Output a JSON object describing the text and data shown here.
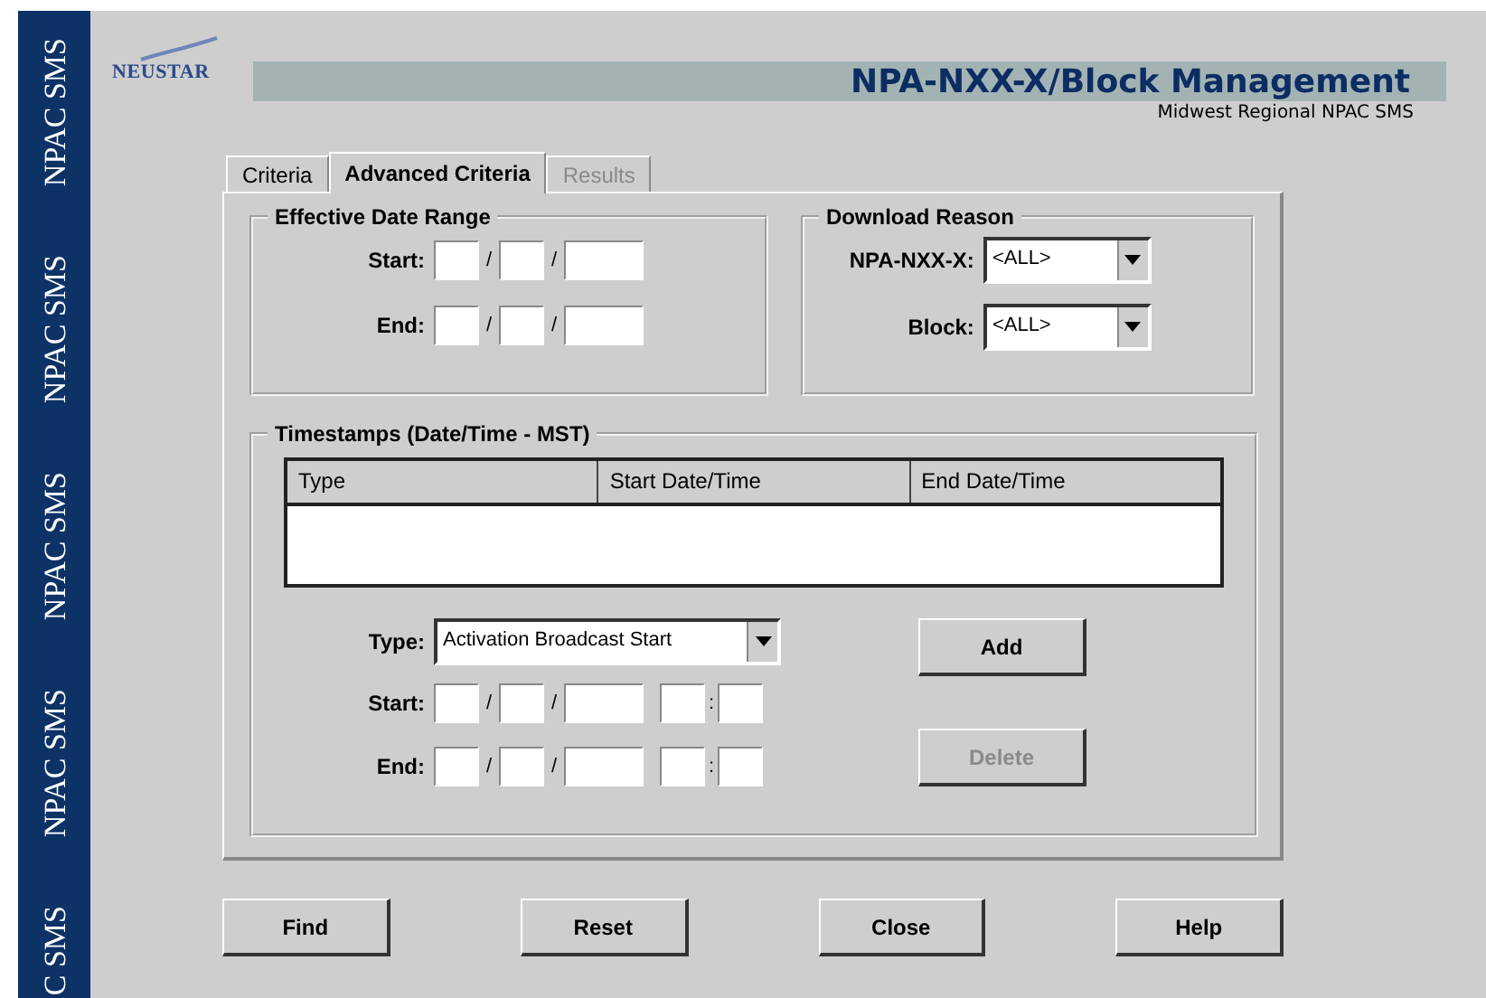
{
  "sidebar": {
    "labels": [
      "NPAC SMS",
      "NPAC SMS",
      "NPAC SMS",
      "NPAC SMS",
      "C SMS"
    ]
  },
  "logo": {
    "text": "NEUSTAR"
  },
  "header": {
    "title": "NPA-NXX-X/Block Management",
    "subtitle": "Midwest Regional NPAC SMS"
  },
  "tabs": [
    {
      "label": "Criteria",
      "selected": false,
      "disabled": false
    },
    {
      "label": "Advanced Criteria",
      "selected": true,
      "disabled": false
    },
    {
      "label": "Results",
      "selected": false,
      "disabled": true
    }
  ],
  "effective_date_range": {
    "title": "Effective Date Range",
    "rows": [
      {
        "label": "Start:",
        "separators": [
          "/",
          "/"
        ]
      },
      {
        "label": "End:",
        "separators": [
          "/",
          "/"
        ]
      }
    ]
  },
  "download_reason": {
    "title": "Download Reason",
    "dropdowns": [
      {
        "label": "NPA-NXX-X:",
        "value": "<ALL>"
      },
      {
        "label": "Block:",
        "value": "<ALL>"
      }
    ]
  },
  "timestamps": {
    "title": "Timestamps (Date/Time - MST)",
    "table": {
      "columns": [
        "Type",
        "Start Date/Time",
        "End Date/Time"
      ]
    },
    "type_dropdown": {
      "label": "Type:",
      "value": "Activation Broadcast Start"
    },
    "rows": [
      {
        "label": "Start:",
        "separators": [
          "/",
          "/",
          ":"
        ]
      },
      {
        "label": "End:",
        "separators": [
          "/",
          "/",
          ":"
        ]
      }
    ],
    "buttons": [
      {
        "label": "Add",
        "disabled": false
      },
      {
        "label": "Delete",
        "disabled": true
      }
    ]
  },
  "buttons": [
    {
      "label": "Find",
      "disabled": false
    },
    {
      "label": "Reset",
      "disabled": false
    },
    {
      "label": "Close",
      "disabled": false
    },
    {
      "label": "Help",
      "disabled": false
    }
  ]
}
